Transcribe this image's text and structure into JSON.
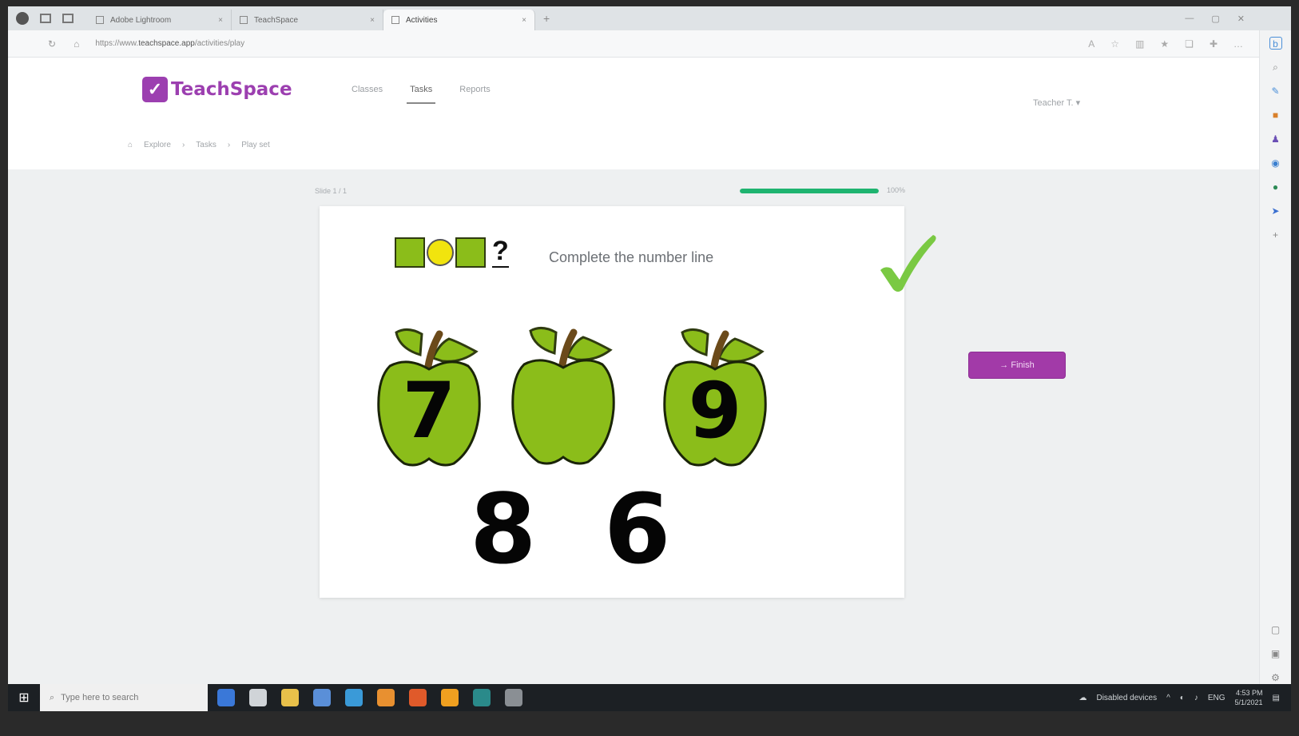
{
  "browser": {
    "tabs": [
      {
        "label": "Adobe Lightroom",
        "active": false
      },
      {
        "label": "TeachSpace",
        "active": false
      },
      {
        "label": "Activities",
        "active": true
      }
    ],
    "new_tab_icon": "plus-icon",
    "url_prefix": "https://www.",
    "url_domain": "teachspace.app",
    "url_path": "/activities/play"
  },
  "site": {
    "logo_mark": "✓",
    "logo_text": "TeachSpace",
    "nav": [
      {
        "label": "Classes",
        "active": false
      },
      {
        "label": "Tasks",
        "active": true
      },
      {
        "label": "Reports",
        "active": false
      }
    ],
    "user_menu": "Teacher T. ▾",
    "breadcrumb": [
      "Explore",
      "Tasks",
      "Play set"
    ]
  },
  "activity": {
    "slide_label": "Slide 1 / 1",
    "progress_percent": 100,
    "progress_text": "100%",
    "instruction": "Complete the number line",
    "pattern_question": "?",
    "apples": [
      {
        "number": "7"
      },
      {
        "number": ""
      },
      {
        "number": "9"
      }
    ],
    "answer_options": [
      "8",
      "6"
    ],
    "finish_button": "→ Finish"
  },
  "taskbar": {
    "search_placeholder": "Type here to search",
    "tray_text": "Disabled devices",
    "lang": "ENG",
    "time": "4:53 PM",
    "date": "5/1/2021"
  },
  "colors": {
    "brand": "#9c3fb0",
    "progress": "#1fb470",
    "apple": "#8bbd1a",
    "check": "#7ac943"
  }
}
